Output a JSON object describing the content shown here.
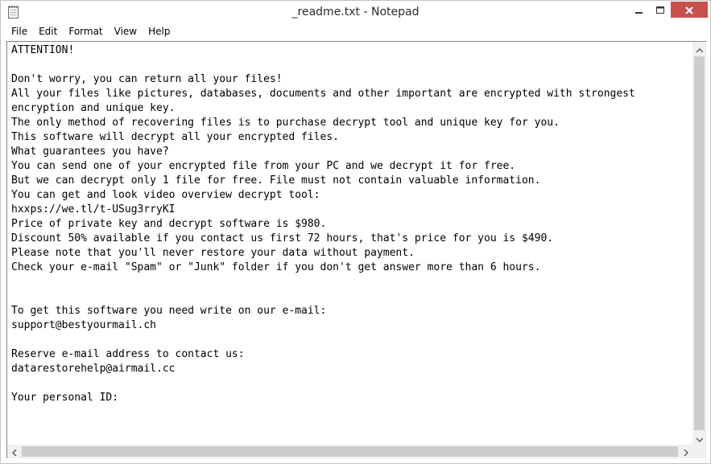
{
  "window": {
    "title": "_readme.txt - Notepad",
    "icon": "notepad-icon",
    "controls": {
      "minimize_icon": "minimize-icon",
      "maximize_icon": "maximize-icon",
      "close_icon": "close-icon",
      "close_color": "#c7504b"
    }
  },
  "menu": {
    "items": [
      "File",
      "Edit",
      "Format",
      "View",
      "Help"
    ]
  },
  "editor": {
    "lines": [
      "ATTENTION!",
      "",
      "Don't worry, you can return all your files!",
      "All your files like pictures, databases, documents and other important are encrypted with strongest",
      "encryption and unique key.",
      "The only method of recovering files is to purchase decrypt tool and unique key for you.",
      "This software will decrypt all your encrypted files.",
      "What guarantees you have?",
      "You can send one of your encrypted file from your PC and we decrypt it for free.",
      "But we can decrypt only 1 file for free. File must not contain valuable information.",
      "You can get and look video overview decrypt tool:",
      "hxxps://we.tl/t-USug3rryKI",
      "Price of private key and decrypt software is $980.",
      "Discount 50% available if you contact us first 72 hours, that's price for you is $490.",
      "Please note that you'll never restore your data without payment.",
      "Check your e-mail \"Spam\" or \"Junk\" folder if you don't get answer more than 6 hours.",
      "",
      "",
      "To get this software you need write on our e-mail:",
      "support@bestyourmail.ch",
      "",
      "Reserve e-mail address to contact us:",
      "datarestorehelp@airmail.cc",
      "",
      "Your personal ID:"
    ]
  },
  "scrollbars": {
    "vertical": {
      "up_icon": "scroll-up-arrow-icon",
      "down_icon": "scroll-down-arrow-icon"
    },
    "horizontal": {
      "left_icon": "scroll-left-arrow-icon",
      "right_icon": "scroll-right-arrow-icon"
    }
  }
}
